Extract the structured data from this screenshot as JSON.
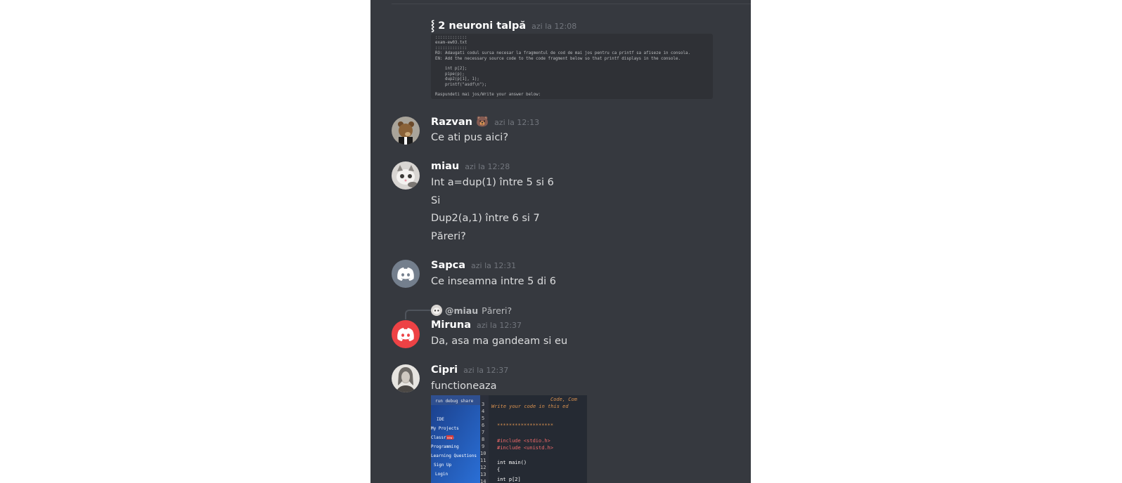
{
  "messages": [
    {
      "id": "m1",
      "username": "⸾ 2 neuroni talpă",
      "timestamp": "azi la 12:08",
      "code": ":::::::::::::\nexam-ew03.txt\n:::::::::::::\nRO: Adaugati codul sursa necesar la fragmentul de cod de mai jos pentru ca printf sa afiseze in consola.\nEN: Add the necessary source code to the code fragment below so that printf displays in the console.\n\n    int p[2];\n    pipe(p);\n    dup2(p[1], 1);\n    printf(\"asdf\\n\");\n\nRaspundeti mai jos/Write your answer below:"
    },
    {
      "id": "m2",
      "username": "Razvan 🐻",
      "timestamp": "azi la 12:13",
      "lines": [
        "Ce ati pus aici?"
      ]
    },
    {
      "id": "m3",
      "username": "miau",
      "timestamp": "azi la 12:28",
      "lines": [
        "Int a=dup(1) între 5 si 6",
        "Si",
        "Dup2(a,1) între 6 si 7",
        "Păreri?"
      ]
    },
    {
      "id": "m4",
      "username": "Sapca",
      "timestamp": "azi la 12:31",
      "lines": [
        "Ce inseamna intre 5 di 6"
      ]
    },
    {
      "id": "m5",
      "username": "Miruna",
      "timestamp": "azi la 12:37",
      "reply_user": "@miau",
      "reply_text": "Păreri?",
      "lines": [
        "Da, asa ma gandeam si eu"
      ]
    },
    {
      "id": "m6",
      "username": "Cipri",
      "timestamp": "azi la 12:37",
      "lines": [
        "functioneaza"
      ],
      "attachment": {
        "menu_items": [
          "run  debug  share",
          "IDE",
          "My Projects",
          "Classroom",
          "Programming",
          "Learning Questions",
          "Sign Up",
          "Login"
        ],
        "menu_badge": "new",
        "line_numbers": [
          "3",
          "4",
          "5",
          "6",
          "7",
          "8",
          "9",
          "10",
          "11",
          "12",
          "13",
          "14"
        ],
        "code_lines": [
          "Code, Com",
          "Write your code in this ed",
          "",
          "",
          "*******************",
          "",
          "#include <stdio.h>",
          "#include <unistd.h>",
          "",
          "int main()",
          "{",
          "  int p[2]"
        ]
      }
    }
  ],
  "colors": {
    "background": "#36393f",
    "username": "#ffffff",
    "text": "#dcddde",
    "timestamp": "#72767d",
    "discord_gray": "#747f8d",
    "discord_red": "#ed4245"
  }
}
